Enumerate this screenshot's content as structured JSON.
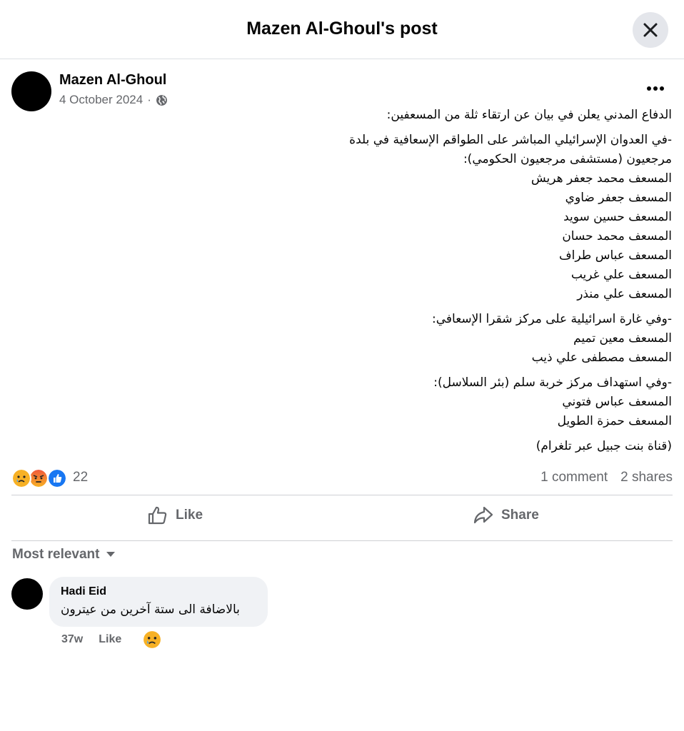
{
  "header": {
    "title": "Mazen Al-Ghoul's post"
  },
  "post": {
    "author": "Mazen Al-Ghoul",
    "date": "4 October 2024",
    "date_separator": "·",
    "privacy_icon": "globe-icon",
    "more_label": "•••",
    "paragraphs": [
      [
        "الدفاع المدني يعلن في بيان عن ارتقاء ثلة من المسعفين:"
      ],
      [
        "-في العدوان الإسرائيلي المباشر على الطواقم الإسعافية في بلدة",
        "مرجعيون (مستشفى مرجعيون الحكومي):",
        "المسعف محمد جعفر هريش",
        "المسعف جعفر ضاوي",
        "المسعف حسين سويد",
        "المسعف محمد حسان",
        "المسعف عباس طراف",
        "المسعف علي غريب",
        "المسعف علي منذر"
      ],
      [
        "-وفي غارة اسرائيلية على مركز شقرا  الإسعافي:",
        "المسعف معين تميم",
        "المسعف مصطفى علي ذيب"
      ],
      [
        "-وفي استهداف مركز خربة سلم (بئر السلاسل):",
        "المسعف عباس فتوني",
        "المسعف حمزة الطويل"
      ],
      [
        "(قناة بنت جبيل عبر تلغرام)"
      ]
    ],
    "reactions": {
      "icons": [
        "sad-icon",
        "angry-icon",
        "like-icon"
      ],
      "count": "22"
    },
    "comments_count": "1 comment",
    "shares_count": "2 shares"
  },
  "actions": {
    "like_label": "Like",
    "share_label": "Share"
  },
  "comments_section": {
    "sort_label": "Most relevant",
    "comments": [
      {
        "author": "Hadi Eid",
        "text": "بالاضافة الى ستة آخرين من عيترون",
        "time": "37w",
        "like_label": "Like",
        "reaction_icon": "sad-icon"
      }
    ]
  },
  "colors": {
    "facebook_blue": "#1877f2",
    "secondary_text": "#65676b",
    "divider": "#ced0d4",
    "bubble_bg": "#f0f2f5"
  }
}
